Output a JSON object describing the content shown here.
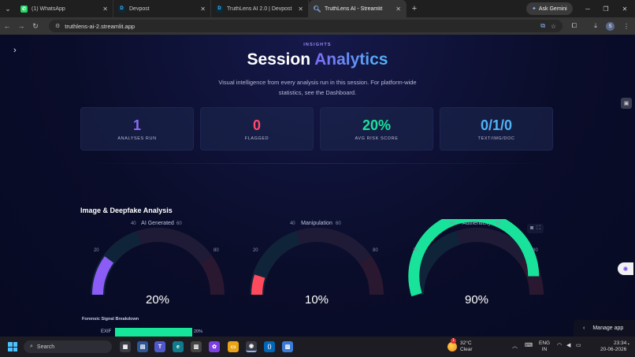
{
  "browser": {
    "tabs": [
      {
        "title": "(1) WhatsApp",
        "favicon": "whatsapp-icon",
        "color": "#25d366"
      },
      {
        "title": "Devpost",
        "favicon": "D",
        "color": "#003e54"
      },
      {
        "title": "TruthLens AI 2.0 | Devpost",
        "favicon": "D",
        "color": "#003e54"
      },
      {
        "title": "TruthLens AI - Streamlit",
        "favicon": "globe-icon",
        "color": "#8ab4f8"
      }
    ],
    "new_tab": "+",
    "ask_gemini": "Ask Gemini",
    "url": "truthlens-ai-2.streamlit.app",
    "profile_initial": "S"
  },
  "header": {
    "eyebrow": "INSIGHTS",
    "title_plain": "Session ",
    "title_accent": "Analytics",
    "subtitle": "Visual intelligence from every analysis run in this session. For platform-wide statistics, see the Dashboard."
  },
  "stats": [
    {
      "value": "1",
      "label": "ANALYSES RUN",
      "color": "#8b6cf6"
    },
    {
      "value": "0",
      "label": "FLAGGED",
      "color": "#ff4a6a"
    },
    {
      "value": "20%",
      "label": "AVG RISK SCORE",
      "color": "#19e39a"
    },
    {
      "value": "0/1/0",
      "label": "TEXT/IMG/DOC",
      "color": "#4fb3f7"
    }
  ],
  "section_title": "Image & Deepfake Analysis",
  "chart_data": [
    {
      "type": "gauge",
      "title": "AI Generated",
      "value": 20,
      "value_label": "20%",
      "range": [
        0,
        100
      ],
      "ticks": [
        "20",
        "40",
        "60",
        "80"
      ],
      "color": "#8b5cf6"
    },
    {
      "type": "gauge",
      "title": "Manipulation",
      "value": 10,
      "value_label": "10%",
      "range": [
        0,
        100
      ],
      "ticks": [
        "20",
        "40",
        "60",
        "80"
      ],
      "color": "#ff4a5e"
    },
    {
      "type": "gauge",
      "title": "Authenticity",
      "value": 90,
      "value_label": "90%",
      "range": [
        0,
        100
      ],
      "ticks": [
        "20",
        "40",
        "60",
        "80"
      ],
      "color": "#19e39a"
    }
  ],
  "forensic": {
    "title": "Forensic Signal Breakdown",
    "bars": [
      {
        "label": "EXIF",
        "value": 20,
        "value_label": "20%",
        "color": "#15e69a"
      }
    ]
  },
  "manage_app": "Manage app",
  "taskbar": {
    "search": "Search",
    "weather_temp": "32°C",
    "weather_desc": "Clear",
    "weather_badge": "1",
    "lang": "ENG",
    "region": "IN",
    "time": "23:34",
    "date": "20-06-2026"
  }
}
